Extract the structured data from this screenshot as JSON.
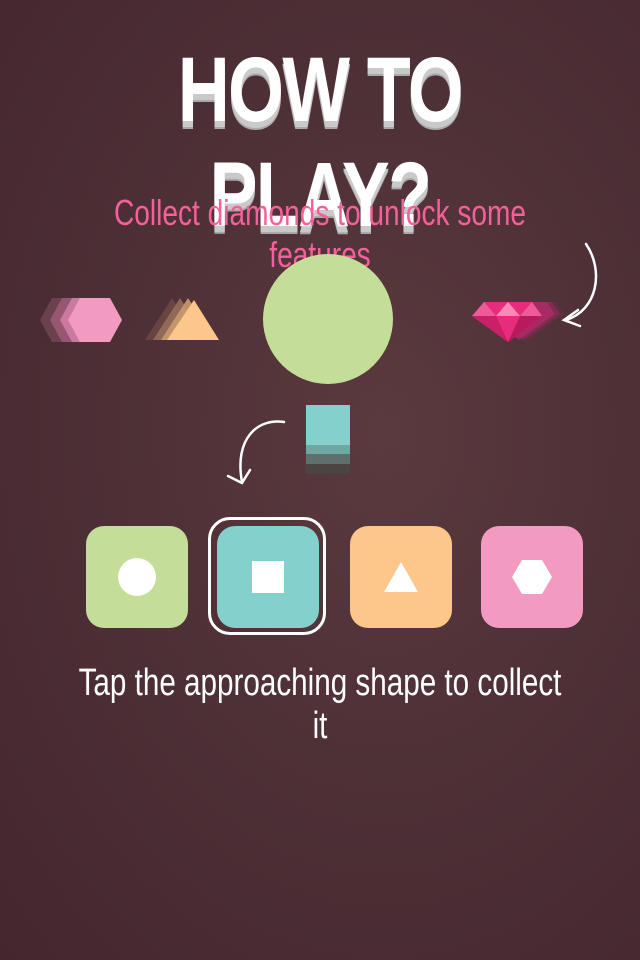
{
  "title": "HOW TO PLAY?",
  "subtitle": "Collect diamonds to unlock some features",
  "hint": "Tap the approaching shape to collect it",
  "colors": {
    "green": "#c4dd98",
    "teal": "#83d0cc",
    "orange": "#fdc68a",
    "pink": "#f39ac1",
    "subtitle": "#f5609a",
    "diamond": "#e62c7c"
  },
  "buttons": [
    {
      "id": "circle",
      "icon": "circle-icon",
      "color": "#c4dd98",
      "selected": false
    },
    {
      "id": "square",
      "icon": "square-icon",
      "color": "#83d0cc",
      "selected": true
    },
    {
      "id": "triangle",
      "icon": "triangle-icon",
      "color": "#fdc68a",
      "selected": false
    },
    {
      "id": "hexagon",
      "icon": "hexagon-icon",
      "color": "#f39ac1",
      "selected": false
    }
  ]
}
